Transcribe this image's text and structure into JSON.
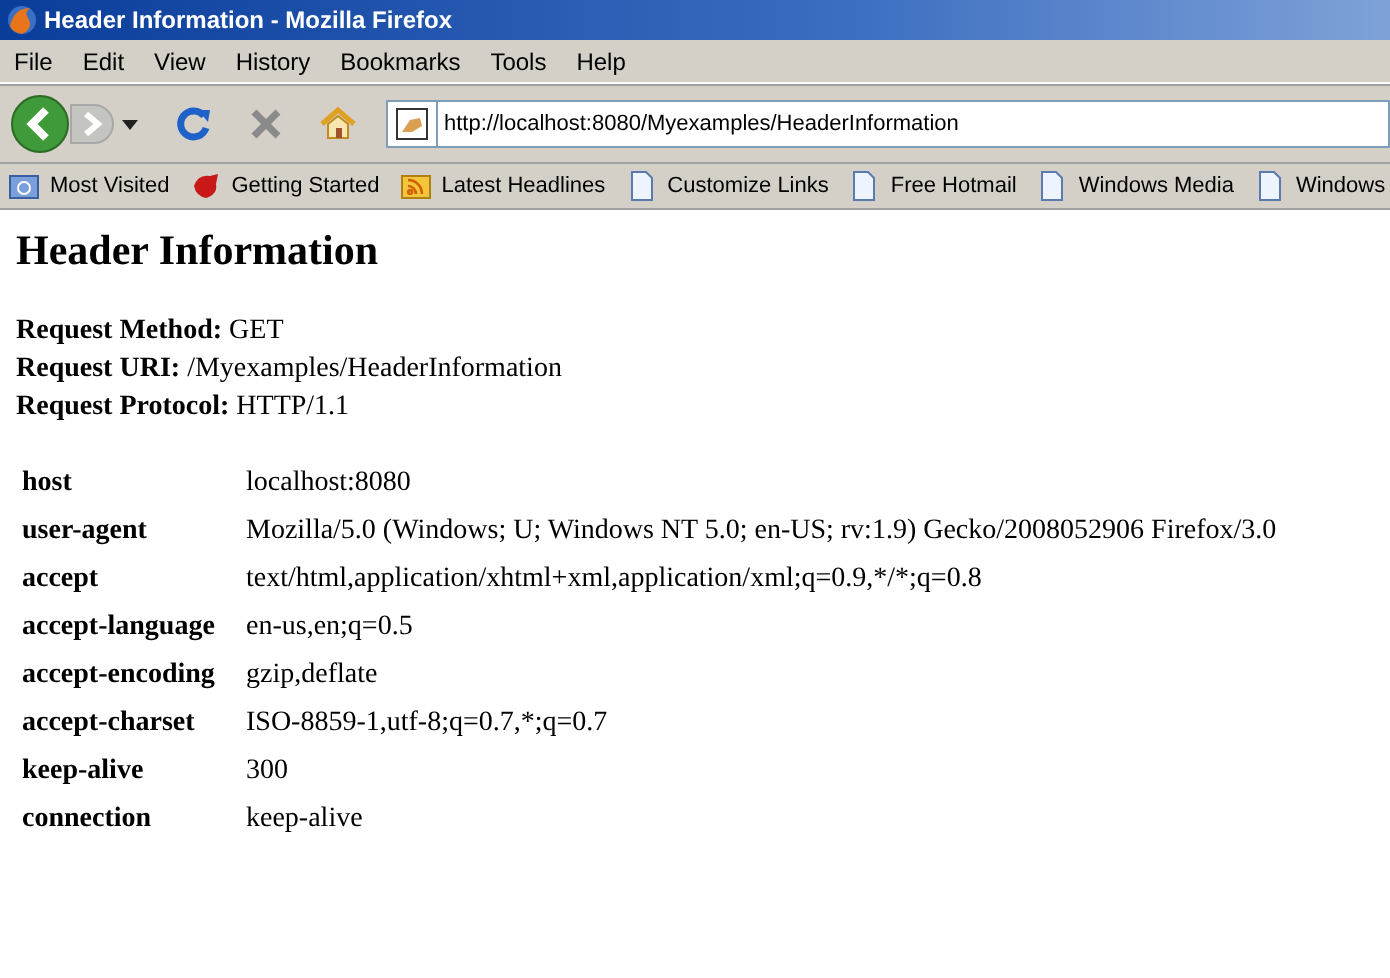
{
  "window": {
    "title": "Header Information - Mozilla Firefox"
  },
  "menu": [
    "File",
    "Edit",
    "View",
    "History",
    "Bookmarks",
    "Tools",
    "Help"
  ],
  "address": {
    "value": "http://localhost:8080/Myexamples/HeaderInformation"
  },
  "bookmarks": [
    {
      "label": "Most Visited",
      "kind": "folder"
    },
    {
      "label": "Getting Started",
      "kind": "fox"
    },
    {
      "label": "Latest Headlines",
      "kind": "feed"
    },
    {
      "label": "Customize Links",
      "kind": "page"
    },
    {
      "label": "Free Hotmail",
      "kind": "page"
    },
    {
      "label": "Windows Media",
      "kind": "page"
    },
    {
      "label": "Windows",
      "kind": "page"
    }
  ],
  "page": {
    "heading": "Header Information",
    "request": [
      {
        "label": "Request Method:",
        "value": "GET"
      },
      {
        "label": "Request URI:",
        "value": "/Myexamples/HeaderInformation"
      },
      {
        "label": "Request Protocol:",
        "value": "HTTP/1.1"
      }
    ],
    "headers": [
      {
        "name": "host",
        "value": "localhost:8080"
      },
      {
        "name": "user-agent",
        "value": "Mozilla/5.0 (Windows; U; Windows NT 5.0; en-US; rv:1.9) Gecko/2008052906 Firefox/3.0"
      },
      {
        "name": "accept",
        "value": "text/html,application/xhtml+xml,application/xml;q=0.9,*/*;q=0.8"
      },
      {
        "name": "accept-language",
        "value": "en-us,en;q=0.5"
      },
      {
        "name": "accept-encoding",
        "value": "gzip,deflate"
      },
      {
        "name": "accept-charset",
        "value": "ISO-8859-1,utf-8;q=0.7,*;q=0.7"
      },
      {
        "name": "keep-alive",
        "value": "300"
      },
      {
        "name": "connection",
        "value": "keep-alive"
      }
    ]
  }
}
